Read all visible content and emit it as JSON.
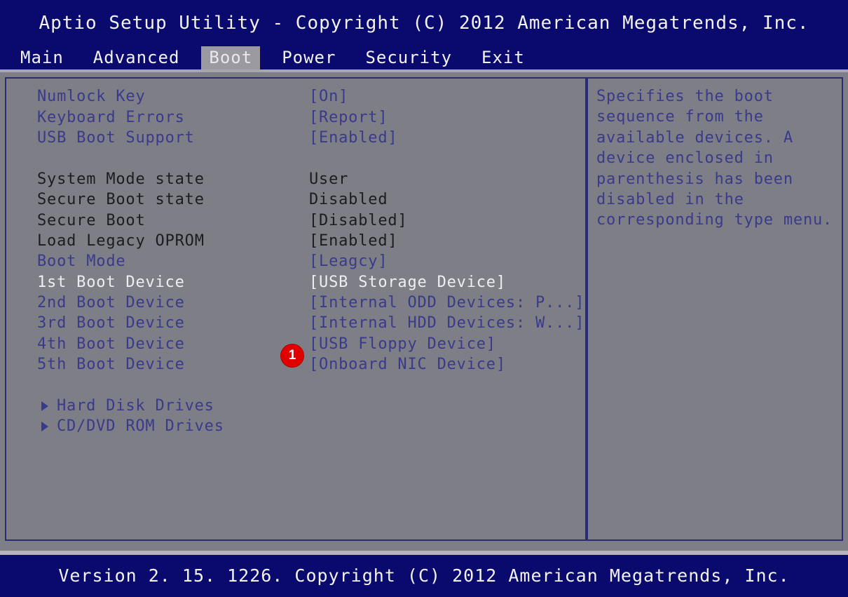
{
  "header": {
    "title": "Aptio Setup Utility - Copyright (C) 2012 American Megatrends, Inc."
  },
  "menu": {
    "tabs": [
      {
        "label": "Main",
        "active": false
      },
      {
        "label": "Advanced",
        "active": false
      },
      {
        "label": "Boot",
        "active": true
      },
      {
        "label": "Power",
        "active": false
      },
      {
        "label": "Security",
        "active": false
      },
      {
        "label": "Exit",
        "active": false
      }
    ]
  },
  "settings": [
    {
      "label": "Numlock Key",
      "value": "[On]",
      "label_color": "blue",
      "value_color": "blue",
      "type": "option"
    },
    {
      "label": "Keyboard Errors",
      "value": "[Report]",
      "label_color": "blue",
      "value_color": "blue",
      "type": "option"
    },
    {
      "label": "USB Boot Support",
      "value": "[Enabled]",
      "label_color": "blue",
      "value_color": "blue",
      "type": "option"
    },
    {
      "label": "",
      "value": "",
      "label_color": "blue",
      "value_color": "blue",
      "type": "spacer"
    },
    {
      "label": "System Mode state",
      "value": "User",
      "label_color": "dark",
      "value_color": "dark",
      "type": "readonly"
    },
    {
      "label": "Secure Boot state",
      "value": "Disabled",
      "label_color": "dark",
      "value_color": "dark",
      "type": "readonly"
    },
    {
      "label": "Secure Boot",
      "value": "[Disabled]",
      "label_color": "dark",
      "value_color": "dark",
      "type": "option"
    },
    {
      "label": "Load Legacy OPROM",
      "value": "[Enabled]",
      "label_color": "dark",
      "value_color": "dark",
      "type": "option"
    },
    {
      "label": "Boot Mode",
      "value": "[Leagcy]",
      "label_color": "blue",
      "value_color": "blue",
      "type": "option"
    },
    {
      "label": "1st Boot Device",
      "value": "[USB Storage Device]",
      "label_color": "white",
      "value_color": "white",
      "type": "option"
    },
    {
      "label": "2nd Boot Device",
      "value": "[Internal ODD Devices: P...]",
      "label_color": "blue",
      "value_color": "blue",
      "type": "option"
    },
    {
      "label": "3rd Boot Device",
      "value": "[Internal HDD Devices: W...]",
      "label_color": "blue",
      "value_color": "blue",
      "type": "option"
    },
    {
      "label": "4th Boot Device",
      "value": "[USB Floppy Device]",
      "label_color": "blue",
      "value_color": "blue",
      "type": "option"
    },
    {
      "label": "5th Boot Device",
      "value": "[Onboard NIC Device]",
      "label_color": "blue",
      "value_color": "blue",
      "type": "option"
    },
    {
      "label": "",
      "value": "",
      "label_color": "blue",
      "value_color": "blue",
      "type": "spacer"
    },
    {
      "label": "Hard Disk Drives",
      "value": "",
      "label_color": "blue",
      "value_color": "blue",
      "type": "submenu"
    },
    {
      "label": "CD/DVD ROM Drives",
      "value": "",
      "label_color": "blue",
      "value_color": "blue",
      "type": "submenu"
    }
  ],
  "help": {
    "text": "Specifies the boot\nsequence from the\navailable devices. A\ndevice enclosed in\nparenthesis has been\ndisabled in the\ncorresponding type menu."
  },
  "annotation": {
    "badge_label": "1"
  },
  "footer": {
    "version": "Version 2. 15. 1226. Copyright (C) 2012 American Megatrends, Inc."
  },
  "colors": {
    "header_blue": "#0a0a6e",
    "panel_gray": "#7e7e86",
    "text_blue": "#3a3a8c",
    "text_dark": "#1c1c20",
    "text_white": "#ededf2",
    "badge_red": "#e00000",
    "border_blue": "#2b2b78"
  }
}
